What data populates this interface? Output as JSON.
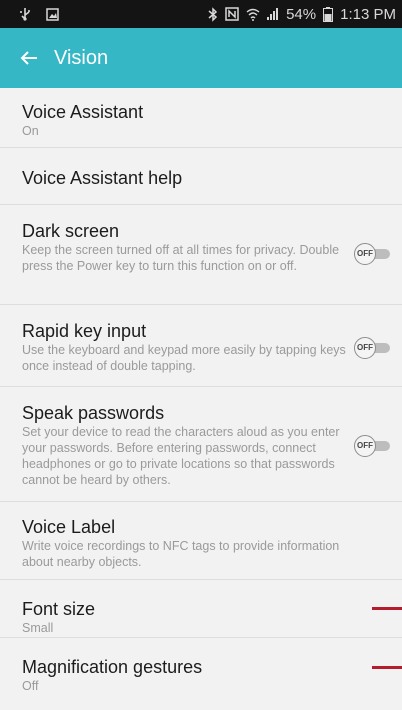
{
  "status_bar": {
    "battery": "54%",
    "time": "1:13 PM",
    "icons": [
      "usb-icon",
      "image-icon",
      "bluetooth-icon",
      "nfc-icon",
      "wifi-icon",
      "signal-icon",
      "battery-icon"
    ]
  },
  "header": {
    "title": "Vision",
    "back_icon": "back-arrow-icon",
    "background": "#35b7c6"
  },
  "settings": [
    {
      "title": "Voice Assistant",
      "subtitle": "On"
    },
    {
      "title": "Voice Assistant help"
    },
    {
      "title": "Dark screen",
      "description": "Keep the screen turned off at all times for privacy. Double press the Power key to turn this function on or off.",
      "toggle": "OFF"
    },
    {
      "title": "Rapid key input",
      "description": "Use the keyboard and keypad more easily by tapping keys once instead of double tapping.",
      "toggle": "OFF"
    },
    {
      "title": "Speak passwords",
      "description": "Set your device to read the characters aloud as you enter your passwords. Before entering passwords, connect headphones or go to private locations so that passwords cannot be heard by others.",
      "toggle": "OFF"
    },
    {
      "title": "Voice Label",
      "description": "Write voice recordings to NFC tags to provide information about nearby objects."
    },
    {
      "title": "Font size",
      "subtitle": "Small"
    },
    {
      "title": "Magnification gestures",
      "subtitle": "Off"
    }
  ],
  "colors": {
    "accent": "#35b7c6",
    "annotation_mark": "#b51c2e"
  }
}
